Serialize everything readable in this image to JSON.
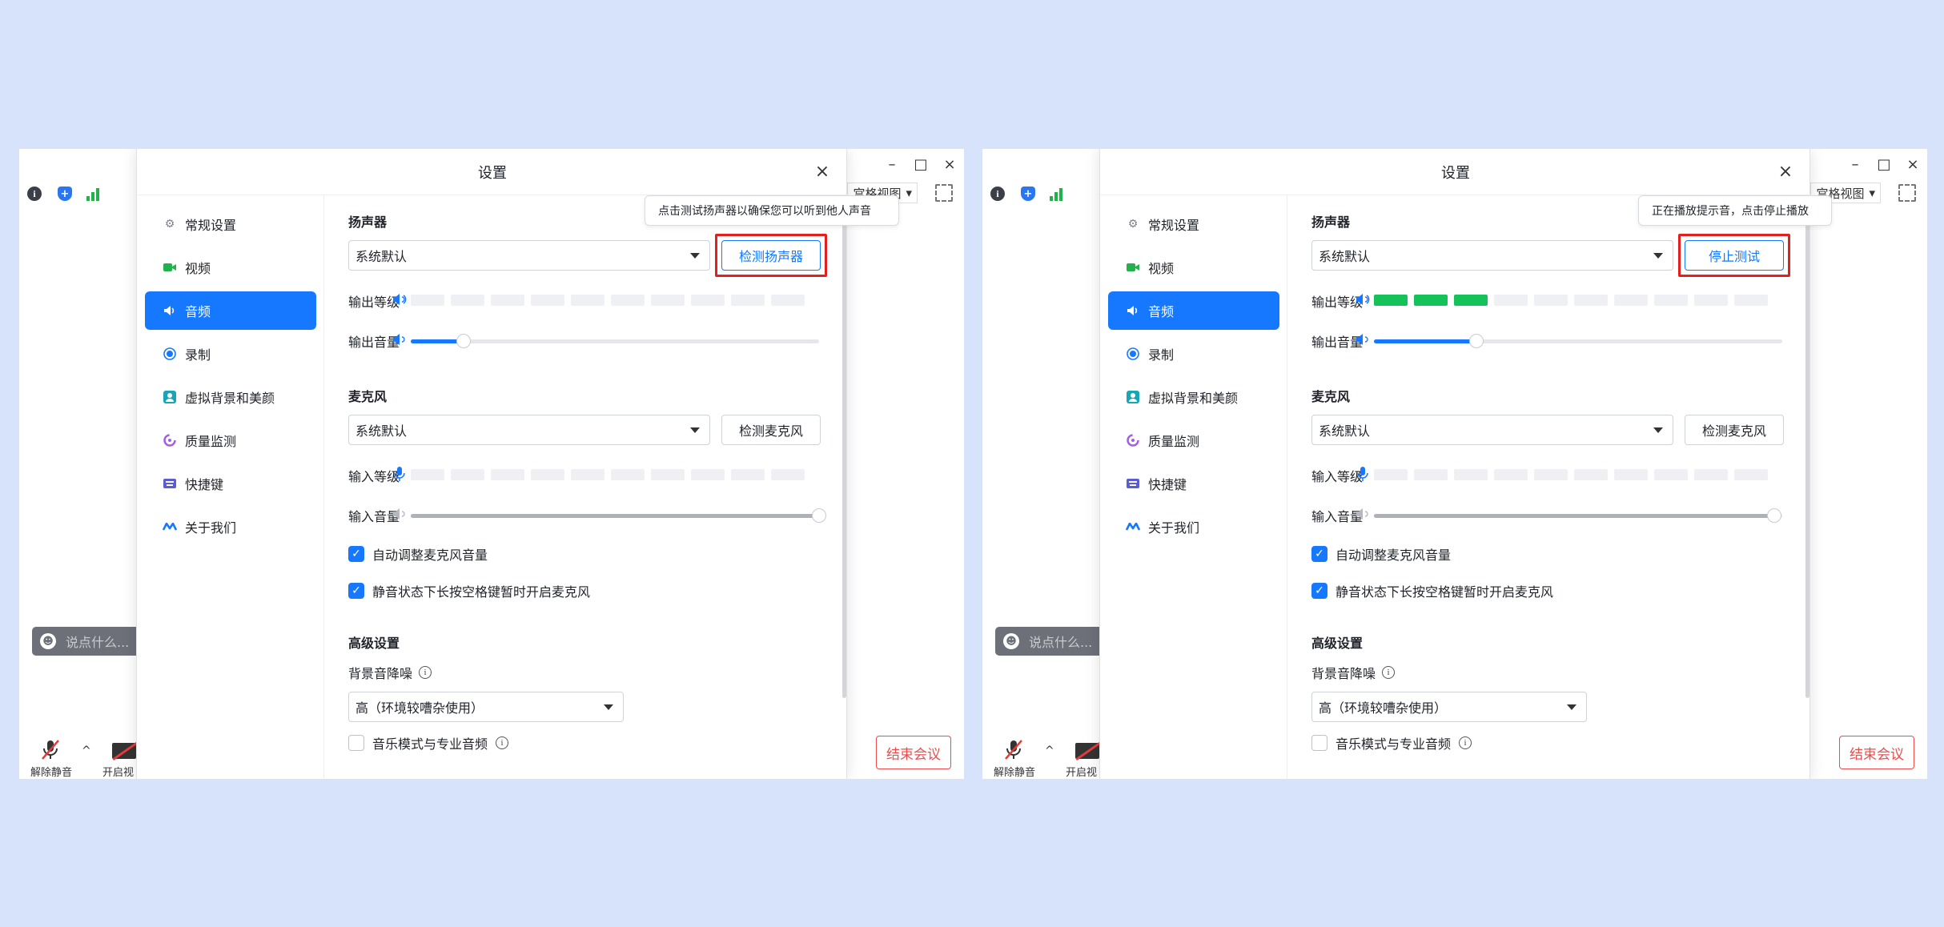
{
  "panels": [
    {
      "background_window": {
        "view_label": "宫格视图",
        "window_controls": [
          "–",
          "□",
          "×"
        ],
        "chat_placeholder": "说点什么...",
        "unmute_label": "解除静音",
        "video_label": "开启视",
        "end_meeting_label": "结束会议"
      },
      "dialog": {
        "title": "设置",
        "close": "×",
        "sidebar": [
          {
            "label": "常规设置",
            "icon": "gear-icon",
            "active": false
          },
          {
            "label": "视频",
            "icon": "video-icon",
            "active": false
          },
          {
            "label": "音频",
            "icon": "speaker-icon",
            "active": true
          },
          {
            "label": "录制",
            "icon": "record-icon",
            "active": false
          },
          {
            "label": "虚拟背景和美颜",
            "icon": "portrait-icon",
            "active": false
          },
          {
            "label": "质量监测",
            "icon": "monitor-icon",
            "active": false
          },
          {
            "label": "快捷键",
            "icon": "keyboard-icon",
            "active": false
          },
          {
            "label": "关于我们",
            "icon": "logo-icon",
            "active": false
          }
        ],
        "speaker": {
          "title": "扬声器",
          "device": "系统默认",
          "test_button": "检测扬声器",
          "tooltip": "点击测试扬声器以确保您可以听到他人声音",
          "output_level_label": "输出等级",
          "output_level_active": 0,
          "output_level_total": 10,
          "output_volume_label": "输出音量",
          "output_volume": 0.13
        },
        "microphone": {
          "title": "麦克风",
          "device": "系统默认",
          "test_button": "检测麦克风",
          "input_level_label": "输入等级",
          "input_level_active": 0,
          "input_level_total": 10,
          "input_volume_label": "输入音量",
          "input_volume": 1.0,
          "auto_adjust_label": "自动调整麦克风音量",
          "auto_adjust_checked": true,
          "space_unmute_label": "静音状态下长按空格键暂时开启麦克风",
          "space_unmute_checked": true
        },
        "advanced": {
          "title": "高级设置",
          "noise_label": "背景音降噪",
          "noise_value": "高（环境较嘈杂使用）",
          "music_mode_label": "音乐模式与专业音频",
          "music_mode_checked": false
        }
      }
    },
    {
      "background_window": {
        "view_label": "宫格视图",
        "window_controls": [
          "–",
          "□",
          "×"
        ],
        "chat_placeholder": "说点什么...",
        "unmute_label": "解除静音",
        "video_label": "开启视",
        "end_meeting_label": "结束会议"
      },
      "dialog": {
        "title": "设置",
        "close": "×",
        "sidebar": [
          {
            "label": "常规设置",
            "icon": "gear-icon",
            "active": false
          },
          {
            "label": "视频",
            "icon": "video-icon",
            "active": false
          },
          {
            "label": "音频",
            "icon": "speaker-icon",
            "active": true
          },
          {
            "label": "录制",
            "icon": "record-icon",
            "active": false
          },
          {
            "label": "虚拟背景和美颜",
            "icon": "portrait-icon",
            "active": false
          },
          {
            "label": "质量监测",
            "icon": "monitor-icon",
            "active": false
          },
          {
            "label": "快捷键",
            "icon": "keyboard-icon",
            "active": false
          },
          {
            "label": "关于我们",
            "icon": "logo-icon",
            "active": false
          }
        ],
        "speaker": {
          "title": "扬声器",
          "device": "系统默认",
          "test_button": "停止测试",
          "tooltip": "正在播放提示音，点击停止播放",
          "output_level_label": "输出等级",
          "output_level_active": 3,
          "output_level_total": 10,
          "output_volume_label": "输出音量",
          "output_volume": 0.25
        },
        "microphone": {
          "title": "麦克风",
          "device": "系统默认",
          "test_button": "检测麦克风",
          "input_level_label": "输入等级",
          "input_level_active": 0,
          "input_level_total": 10,
          "input_volume_label": "输入音量",
          "input_volume": 0.98,
          "auto_adjust_label": "自动调整麦克风音量",
          "auto_adjust_checked": true,
          "space_unmute_label": "静音状态下长按空格键暂时开启麦克风",
          "space_unmute_checked": true
        },
        "advanced": {
          "title": "高级设置",
          "noise_label": "背景音降噪",
          "noise_value": "高（环境较嘈杂使用）",
          "music_mode_label": "音乐模式与专业音频",
          "music_mode_checked": false
        }
      }
    }
  ],
  "colors": {
    "accent": "#1677ff",
    "highlight": "#e41f1f",
    "level_on": "#15c25a",
    "danger": "#ee4b4b",
    "page_bg": "#d7e3fb"
  }
}
